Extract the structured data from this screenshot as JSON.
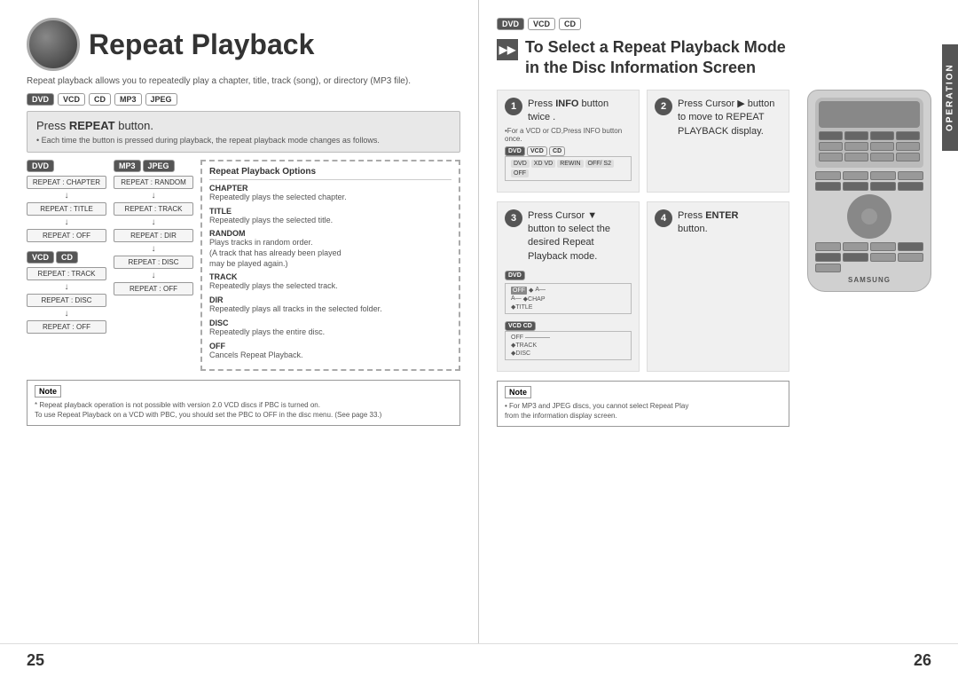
{
  "left_page": {
    "number": "25",
    "title": "Repeat Playback",
    "subtitle": "Repeat playback allows you to repeatedly play a chapter, title, track (song), or directory (MP3 file).",
    "badges": [
      "DVD",
      "VCD",
      "CD",
      "MP3",
      "JPEG"
    ],
    "repeat_section": {
      "title_prefix": "Press ",
      "title_bold": "REPEAT",
      "title_suffix": " button.",
      "note": "• Each time the button is pressed during playback, the repeat playback mode changes as follows."
    },
    "dvd_column": {
      "label": "DVD",
      "items": [
        "REPEAT : CHAPTER",
        "↓",
        "REPEAT : TITLE",
        "↓",
        "REPEAT : OFF"
      ]
    },
    "mp3_column": {
      "label1": "MP3",
      "label2": "JPEG",
      "items": [
        "REPEAT : RANDOM",
        "↓",
        "REPEAT : TRACK",
        "↓",
        "REPEAT : DIR",
        "↓",
        "REPEAT : DISC",
        "↓",
        "REPEAT : OFF"
      ]
    },
    "vcd_column": {
      "label1": "VCD",
      "label2": "CD",
      "items": [
        "REPEAT : TRACK",
        "↓",
        "REPEAT : DISC",
        "↓",
        "REPEAT : OFF"
      ]
    },
    "options_box": {
      "title": "Repeat Playback Options",
      "options": [
        {
          "name": "CHAPTER",
          "desc": "Repeatedly plays the selected chapter."
        },
        {
          "name": "TITLE",
          "desc": "Repeatedly plays the selected title."
        },
        {
          "name": "RANDOM",
          "desc": "Plays tracks in random order.\n(A track that has already been played\nmay be played again.)"
        },
        {
          "name": "TRACK",
          "desc": "Repeatedly plays the selected track."
        },
        {
          "name": "DIR",
          "desc": "Repeatedly plays all tracks in the selected folder."
        },
        {
          "name": "DISC",
          "desc": "Repeatedly plays the entire disc."
        },
        {
          "name": "OFF",
          "desc": "Cancels Repeat Playback."
        }
      ]
    },
    "note_box": {
      "label": "Note",
      "lines": [
        "* Repeat playback operation is not possible with version 2.0 VCD discs if PBC is turned on.",
        "To use Repeat Playback on a VCD with PBC, you should set the PBC to OFF in the disc menu. (See page 33.)"
      ]
    }
  },
  "right_page": {
    "number": "26",
    "badges": [
      "DVD",
      "VCD",
      "CD"
    ],
    "section_icon": "▶▶",
    "title_line1": "To Select a Repeat Playback Mode",
    "title_line2": "in the Disc Information Screen",
    "steps": [
      {
        "number": "1",
        "text_prefix": "Press ",
        "text_bold": "INFO",
        "text_suffix": " button twice ."
      },
      {
        "number": "2",
        "text": "Press Cursor ▶ button\nto move to REPEAT\nPLAYBACK display."
      },
      {
        "number": "3",
        "text": "Press Cursor ▼\nbutton to select the\ndesired Repeat\nPlayback mode."
      },
      {
        "number": "4",
        "text_prefix": "Press ",
        "text_bold": "ENTER",
        "text_suffix": "\nbutton."
      }
    ],
    "info_note": "•For a VCD or CD,Press INFO button once.",
    "dvd_display": {
      "label": "DVD",
      "rows": [
        [
          "DVD",
          "VCD",
          "REWIND",
          "OFF/S2",
          "OFF"
        ],
        [
          "OFF",
          "A-",
          "A-",
          "CHAP",
          "TITLE"
        ]
      ]
    },
    "vcd_display": {
      "label": "VCD CD",
      "rows": [
        [
          "OFF",
          "TRACK",
          "DISC"
        ]
      ]
    },
    "operation_sidebar": "OPERATION",
    "note_box": {
      "label": "Note",
      "lines": [
        "• For MP3 and JPEG discs, you cannot select Repeat Play",
        "from the information display screen."
      ]
    },
    "samsung_label": "SAMSUNG"
  }
}
